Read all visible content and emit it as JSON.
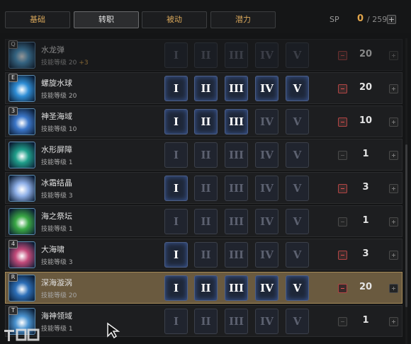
{
  "tabs": [
    {
      "label": "基础"
    },
    {
      "label": "转职"
    },
    {
      "label": "被动"
    },
    {
      "label": "潜力"
    }
  ],
  "sp": {
    "label": "SP",
    "current": "0",
    "total": "/ 259",
    "plus": "+"
  },
  "level_prefix": "技能等级",
  "ranks": [
    "I",
    "II",
    "III",
    "IV",
    "V"
  ],
  "skills": [
    {
      "name": "水龙弹",
      "hotkey": "Q",
      "level_text": "技能等级 20",
      "bonus": "+3",
      "level": "20",
      "ranks_active": 0,
      "dim": true,
      "selected": false,
      "icon_color": "#4fa3d8"
    },
    {
      "name": "螺旋水球",
      "hotkey": "E",
      "level_text": "技能等级 20",
      "bonus": "",
      "level": "20",
      "ranks_active": 5,
      "dim": false,
      "selected": false,
      "icon_color": "#2f8ed6"
    },
    {
      "name": "神圣海域",
      "hotkey": "3",
      "level_text": "技能等级 10",
      "bonus": "",
      "level": "10",
      "ranks_active": 3,
      "dim": false,
      "selected": false,
      "icon_color": "#3b76c8"
    },
    {
      "name": "水形屏障",
      "hotkey": "",
      "level_text": "技能等级 1",
      "bonus": "",
      "level": "1",
      "ranks_active": 0,
      "dim": false,
      "selected": false,
      "icon_color": "#1f9e8a"
    },
    {
      "name": "冰霜结晶",
      "hotkey": "",
      "level_text": "技能等级 3",
      "bonus": "",
      "level": "3",
      "ranks_active": 1,
      "dim": false,
      "selected": false,
      "icon_color": "#8fb0e8"
    },
    {
      "name": "海之祭坛",
      "hotkey": "",
      "level_text": "技能等级 1",
      "bonus": "",
      "level": "1",
      "ranks_active": 0,
      "dim": false,
      "selected": false,
      "icon_color": "#3aa845"
    },
    {
      "name": "大海啸",
      "hotkey": "4",
      "level_text": "技能等级 3",
      "bonus": "",
      "level": "3",
      "ranks_active": 1,
      "dim": false,
      "selected": false,
      "icon_color": "#c24a7a"
    },
    {
      "name": "深海漩涡",
      "hotkey": "R",
      "level_text": "技能等级 20",
      "bonus": "",
      "level": "20",
      "ranks_active": 5,
      "dim": false,
      "selected": true,
      "icon_color": "#2d6fb8"
    },
    {
      "name": "海神领域",
      "hotkey": "T",
      "level_text": "技能等级 1",
      "bonus": "",
      "level": "1",
      "ranks_active": 0,
      "dim": false,
      "selected": false,
      "icon_color": "#4a93d0"
    }
  ]
}
